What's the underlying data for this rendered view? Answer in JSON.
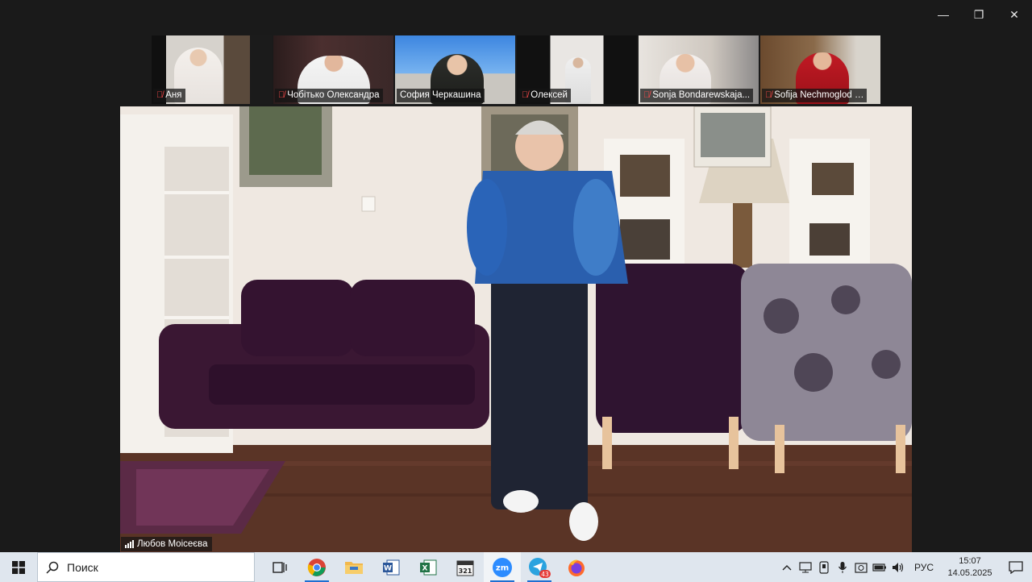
{
  "window": {
    "minimize_glyph": "—",
    "restore_glyph": "❐",
    "close_glyph": "✕"
  },
  "participants": [
    {
      "name": "Аня",
      "muted": true
    },
    {
      "name": "Чобітько Олександра",
      "muted": true
    },
    {
      "name": "София Черкашина",
      "muted": false
    },
    {
      "name": "Олексей",
      "muted": true
    },
    {
      "name": "Sonja Bondarewskaja...",
      "muted": true
    },
    {
      "name": "Sofija Nechmoglod …",
      "muted": true
    }
  ],
  "main_speaker": {
    "name": "Любов Моісеєва"
  },
  "taskbar": {
    "search_placeholder": "Поиск",
    "apps": [
      "task-view",
      "chrome",
      "file-explorer",
      "word",
      "excel",
      "calendar-321",
      "zoom",
      "telegram",
      "firefox"
    ],
    "telegram_badge": "43",
    "zoom_label": "zm",
    "calendar_label": "321",
    "language": "РУС",
    "time": "15:07",
    "date": "14.05.2025"
  },
  "colors": {
    "taskbar_bg": "#dfe6ee",
    "mute_red": "#ff4a4a",
    "zoom_blue": "#2d8cff"
  }
}
